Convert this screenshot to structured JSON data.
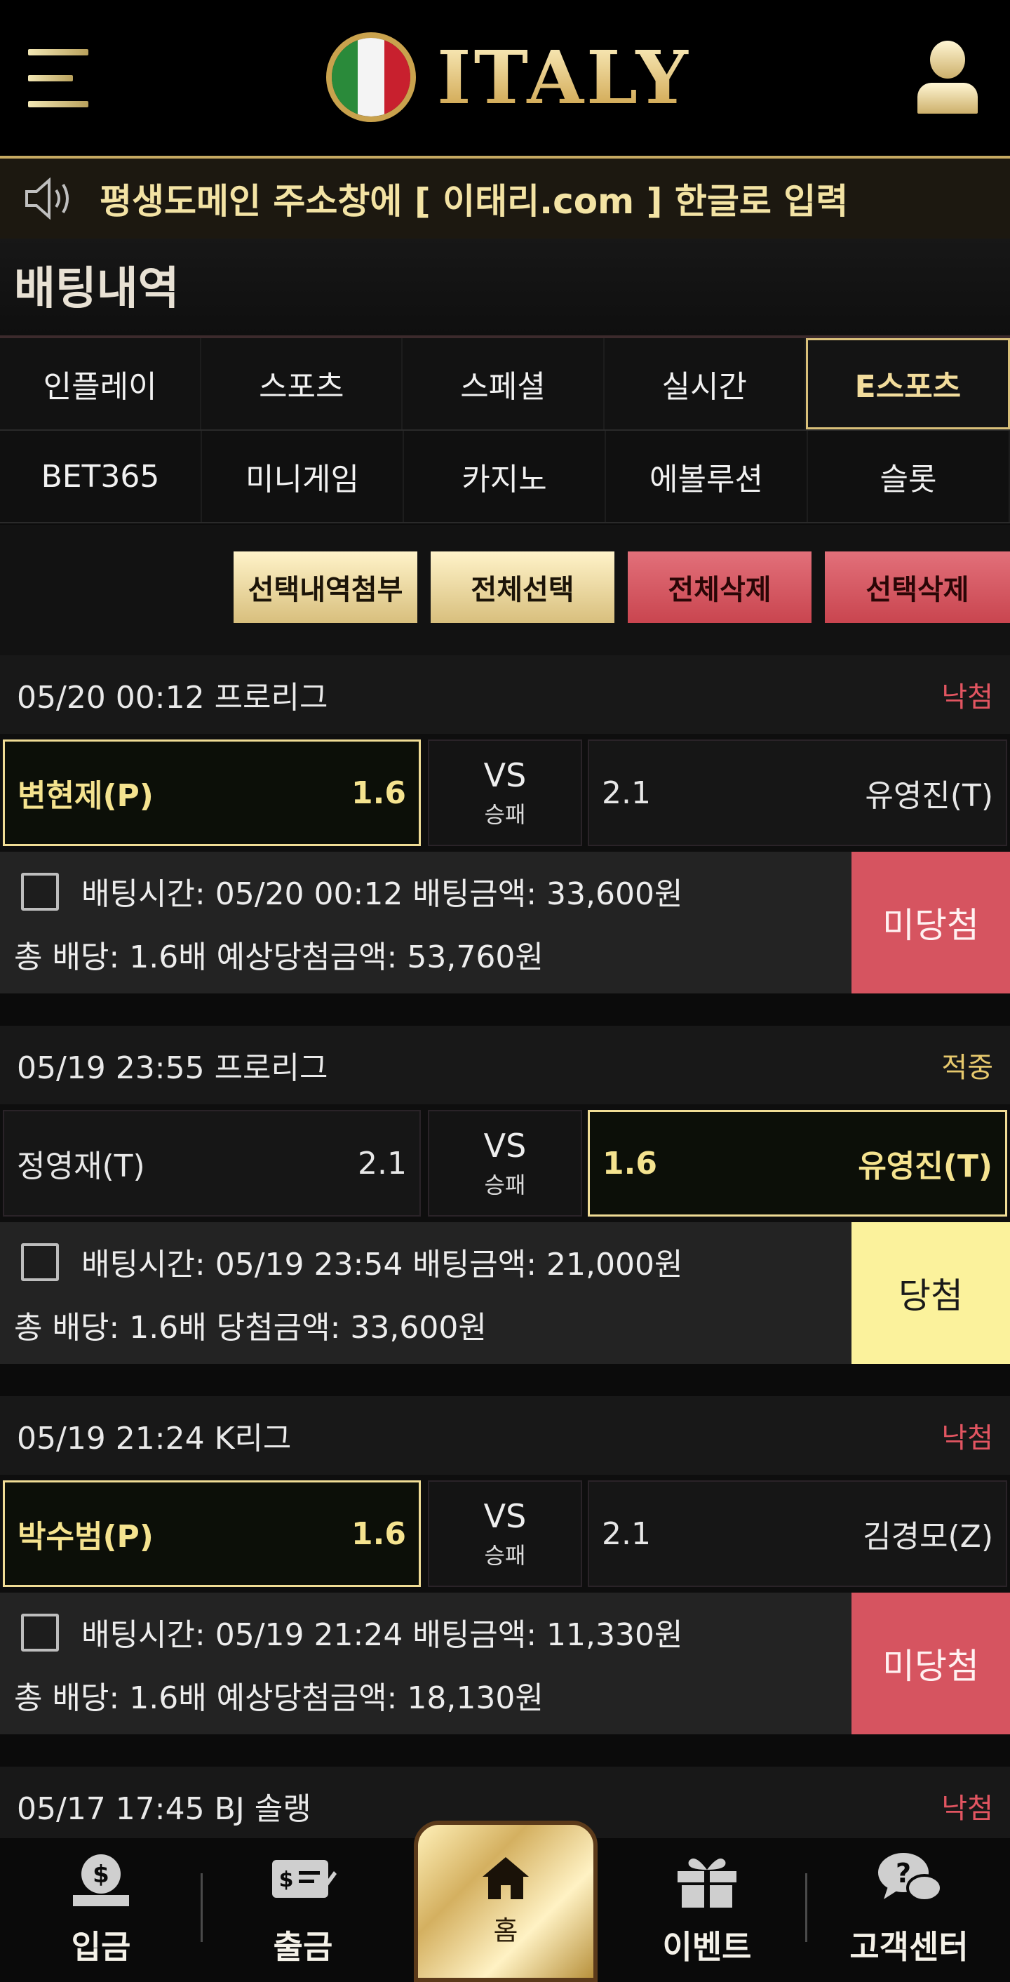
{
  "header": {
    "logo_text": "ITALY"
  },
  "notice": {
    "text": "평생도메인 주소창에 [ 이태리.com ] 한글로 입력"
  },
  "page": {
    "title": "배팅내역"
  },
  "tabs": {
    "row1": [
      {
        "label": "인플레이",
        "active": false
      },
      {
        "label": "스포츠",
        "active": false
      },
      {
        "label": "스페셜",
        "active": false
      },
      {
        "label": "실시간",
        "active": false
      },
      {
        "label": "E스포츠",
        "active": true
      }
    ],
    "row2": [
      {
        "label": "BET365"
      },
      {
        "label": "미니게임"
      },
      {
        "label": "카지노"
      },
      {
        "label": "에볼루션"
      },
      {
        "label": "슬롯"
      }
    ]
  },
  "actions": {
    "attach": "선택내역첨부",
    "select_all": "전체선택",
    "delete_all": "전체삭제",
    "delete_selected": "선택삭제"
  },
  "bets": [
    {
      "header": "05/20 00:12 프로리그",
      "result": "낙첨",
      "home": {
        "name": "변현제(P)",
        "odds": "1.6"
      },
      "vs": "VS",
      "type": "승패",
      "away": {
        "odds": "2.1",
        "name": "유영진(T)"
      },
      "line1": "배팅시간: 05/20 00:12  배팅금액: 33,600원",
      "line2": "총 배당: 1.6배  예상당첨금액: 53,760원",
      "status": "미당첨"
    },
    {
      "header": "05/19 23:55 프로리그",
      "result": "적중",
      "home": {
        "name": "정영재(T)",
        "odds": "2.1"
      },
      "vs": "VS",
      "type": "승패",
      "away": {
        "odds": "1.6",
        "name": "유영진(T)"
      },
      "line1": "배팅시간: 05/19 23:54  배팅금액: 21,000원",
      "line2": "총 배당: 1.6배  당첨금액: 33,600원",
      "status": "당첨"
    },
    {
      "header": "05/19 21:24 K리그",
      "result": "낙첨",
      "home": {
        "name": "박수범(P)",
        "odds": "1.6"
      },
      "vs": "VS",
      "type": "승패",
      "away": {
        "odds": "2.1",
        "name": "김경모(Z)"
      },
      "line1": "배팅시간: 05/19 21:24  배팅금액: 11,330원",
      "line2": "총 배당: 1.6배  예상당첨금액: 18,130원",
      "status": "미당첨"
    },
    {
      "header": "05/17 17:45 BJ 솔랭",
      "result": "낙첨"
    }
  ],
  "bottom_nav": {
    "deposit": "입금",
    "withdraw": "출금",
    "home": "홈",
    "event": "이벤트",
    "support": "고객센터"
  },
  "colors": {
    "gold": "#d9c07a",
    "lose": "#d65460",
    "win": "#fbf29c",
    "background": "#0b0b0b"
  }
}
